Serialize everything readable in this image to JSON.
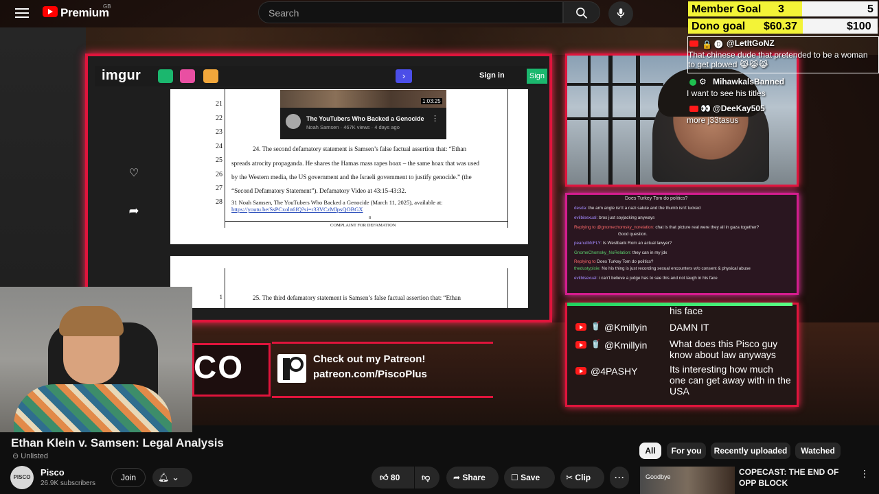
{
  "header": {
    "brand": "Premium",
    "region": "GB",
    "search_placeholder": "Search"
  },
  "video_overlay": {
    "imgur": {
      "logo": "imgur",
      "sign_in": "Sign in",
      "sign_up": "Sign"
    },
    "embedded_video_card": {
      "title": "The YouTubers Who Backed a Genocide",
      "meta": "Noah Samsen · 467K views · 4 days ago",
      "duration": "1:03:25"
    },
    "document": {
      "line_numbers": [
        "21",
        "22",
        "23",
        "24",
        "25",
        "26",
        "27",
        "28"
      ],
      "para_24_line1": "24.     The second defamatory statement is Samsen’s false factual assertion that: “Ethan",
      "para_24_line2": "spreads atrocity propaganda. He shares the Hamas mass rapes hoax – the same hoax that was used",
      "para_24_line3": "by the Western media, the US government and the Israeli government to justify genocide.” (the",
      "para_24_line4": "“Second Defamatory Statement”). Defamatory Video at 43:15-43:32.",
      "footnote": "31 Noah Samsen, The YouTubers Who Backed a Genocide (March 11, 2025), available at:",
      "footnote_link": "https://youtu.be/SsPCxoln6fQ?si=r33VCzMIpsQOBGX",
      "page_number": "8",
      "footer": "COMPLAINT FOR DEFAMATION",
      "page2_line_number": "1",
      "para_25": "25.     The third defamatory statement is Samsen’s false factual assertion that: “Ethan"
    },
    "twitch_chat": {
      "title": "Does Turkey Tom do politics?",
      "lines": [
        {
          "user": "desda:",
          "text": "the arm angle isn't a nazi salute and the thumb isn't tucked"
        },
        {
          "user": "evilbisexual:",
          "text": "bros just soyjacking anyways"
        },
        {
          "user": "Replying to @gnomechomsky_norelation:",
          "text": "chat is that picture real were they all in gaza together?"
        },
        {
          "user": "",
          "text": "Good question."
        },
        {
          "user": "peanutMcFLY:",
          "text": "Is Westbank Rom an actual lawyer?"
        },
        {
          "user": "GnomeChomsky_NoRelation:",
          "text": "they can in my jdx"
        },
        {
          "user": "Replying to",
          "text": "Does Turkey Tom do politics?"
        },
        {
          "user": "thedustypixie:",
          "text": "No his thing is just recording sexual encounters w/o consent & physical abuse"
        },
        {
          "user": "evilbisexual:",
          "text": "i can't believe a judge has to see this and not laugh in his face"
        }
      ]
    },
    "yt_chat": {
      "partial_top": "his face",
      "messages": [
        {
          "user": "@Kmillyin",
          "text": "DAMN IT"
        },
        {
          "user": "@Kmillyin",
          "text": "What does this Pisco guy know about law anyways"
        },
        {
          "user": "@4PASHY",
          "text": "Its interesting how much one can get away with in the USA"
        }
      ]
    },
    "channel_logo_text": "CO",
    "patreon": {
      "line1": "Check out my Patreon!",
      "line2": "patreon.com/PiscoPlus"
    },
    "goals": {
      "member_label": "Member Goal",
      "member_current": "3",
      "member_target": "5",
      "member_progress": 0.6,
      "dono_label": "Dono goal",
      "dono_current": "$60.37",
      "dono_target": "$100",
      "dono_progress": 0.6037
    },
    "overlay_chat": [
      {
        "user": "@LetItGoNZ",
        "text": "That chinese dude that pretended to be a woman",
        "text2": "to get plowed 😹😹😹"
      },
      {
        "user": "MihawkalsBanned",
        "text": "I want to see his titles"
      },
      {
        "user": "@DeeKay505",
        "text": "more j33tasus"
      }
    ]
  },
  "video": {
    "title": "Ethan Klein v. Samsen: Legal Analysis",
    "visibility": "Unlisted"
  },
  "channel": {
    "avatar_text": "PISCO",
    "name": "Pisco",
    "subscribers": "26.9K subscribers",
    "join_label": "Join"
  },
  "actions": {
    "like_count": "80",
    "share_label": "Share",
    "save_label": "Save",
    "clip_label": "Clip"
  },
  "chips": [
    "All",
    "For you",
    "Recently uploaded",
    "Watched"
  ],
  "recommendation": {
    "thumb_text": "Goodbye",
    "title": "COPECAST: THE END OF OPP BLOCK"
  },
  "icons": {
    "menu": "hamburger-icon",
    "search": "search-icon",
    "mic": "mic-icon",
    "bell": "bell-icon",
    "like": "thumbs-up-icon",
    "dislike": "thumbs-down-icon",
    "share": "share-icon",
    "save": "save-icon",
    "clip": "scissors-icon",
    "more": "more-icon"
  },
  "colors": {
    "accent_red": "#e0143c",
    "accent_pink": "#d41d8f",
    "goal_yellow": "#f3f337",
    "yt_red": "#ff0000"
  }
}
